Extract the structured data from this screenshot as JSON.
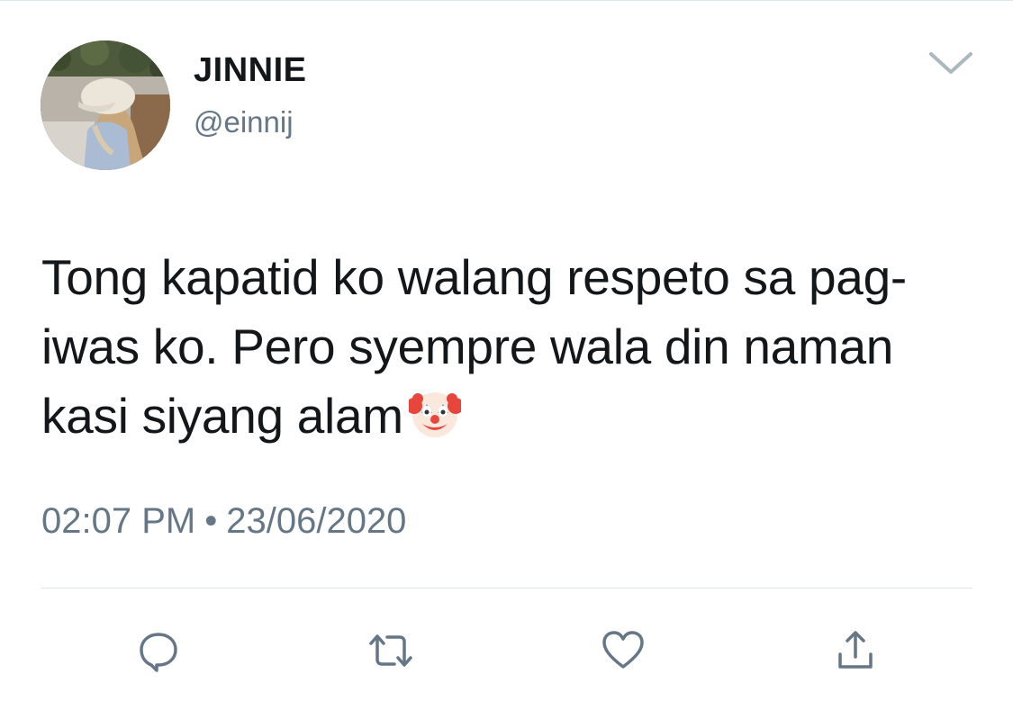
{
  "user": {
    "display_name": "JINNIE",
    "handle": "@einnij"
  },
  "tweet": {
    "text": "Tong kapatid ko walang respeto sa pag-iwas ko. Pero syempre wala din naman kasi siyang alam",
    "emoji": "clown-face-emoji",
    "time": "02:07 PM",
    "separator": "•",
    "date": "23/06/2020"
  },
  "icons": {
    "caret": "chevron-down-icon",
    "reply": "reply-icon",
    "retweet": "retweet-icon",
    "like": "heart-icon",
    "share": "share-icon"
  },
  "colors": {
    "text": "#14171a",
    "secondary": "#657786",
    "icon": "#657786",
    "divider": "#dce3e8"
  }
}
